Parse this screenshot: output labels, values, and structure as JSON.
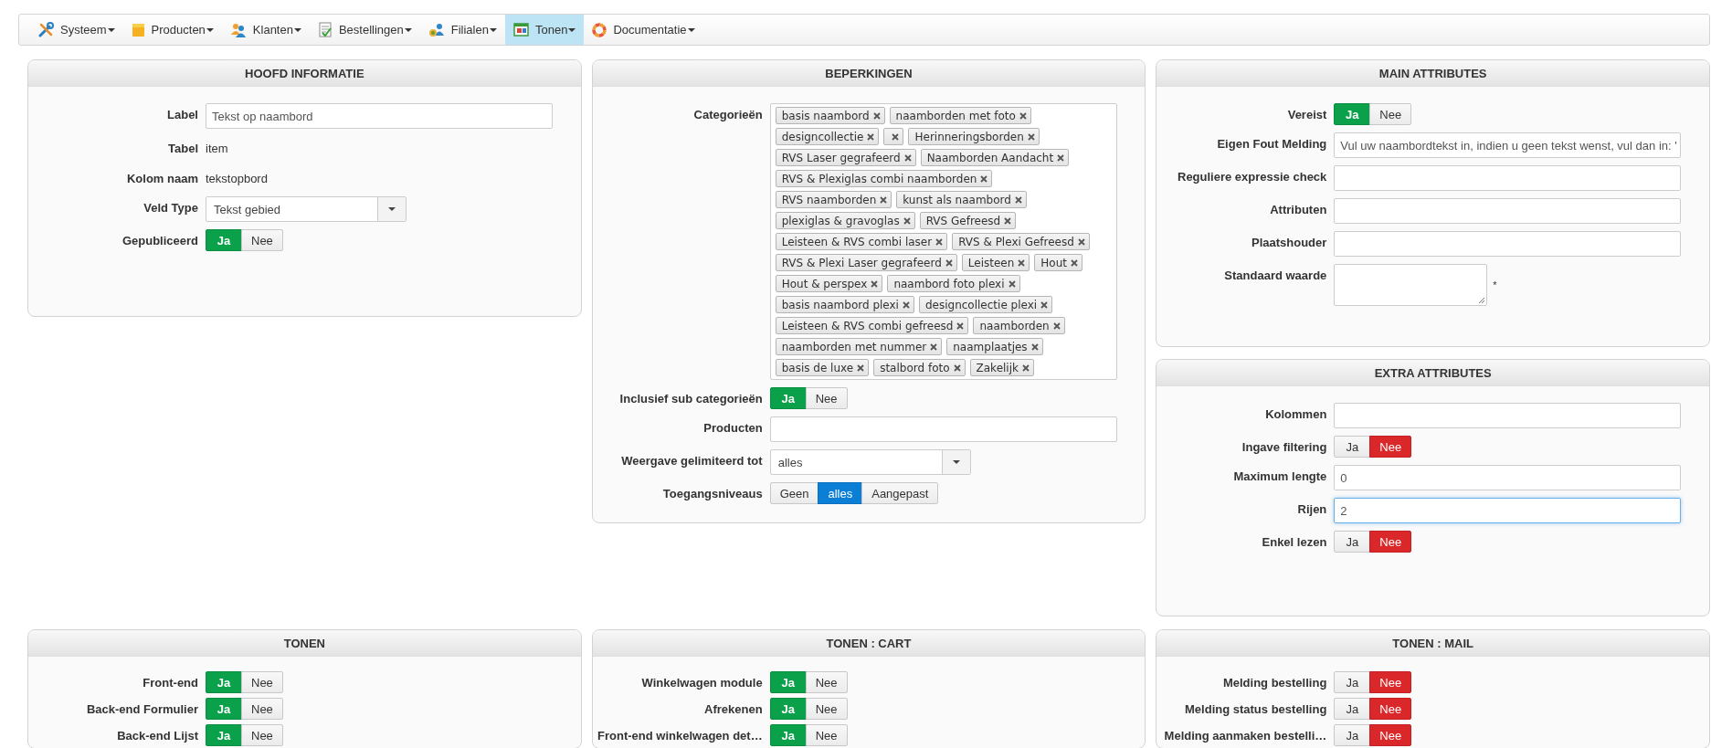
{
  "nav": {
    "items": [
      {
        "label": "Systeem",
        "selected": false
      },
      {
        "label": "Producten",
        "selected": false
      },
      {
        "label": "Klanten",
        "selected": false
      },
      {
        "label": "Bestellingen",
        "selected": false
      },
      {
        "label": "Filialen",
        "selected": false
      },
      {
        "label": "Tonen",
        "selected": true
      },
      {
        "label": "Documentatie",
        "selected": false
      }
    ]
  },
  "top_row": {
    "columns": [
      [
        {
          "title": "HOOFD INFORMATIE",
          "rows": [
            {
              "kind": "input",
              "label": "Label",
              "value": "Tekst op naambord",
              "focused": false
            },
            {
              "kind": "text",
              "label": "Tabel",
              "value": "item"
            },
            {
              "kind": "text",
              "label": "Kolom naam",
              "value": "tekstopbord"
            },
            {
              "kind": "select",
              "label": "Veld Type",
              "value": "Tekst gebied"
            },
            {
              "kind": "toggle",
              "label": "Gepubliceerd",
              "options": [
                {
                  "label": "Ja",
                  "selected": true
                },
                {
                  "label": "Nee",
                  "selected": false
                }
              ]
            }
          ]
        }
      ],
      [
        {
          "title": "BEPERKINGEN",
          "rows": [
            {
              "kind": "tags",
              "label": "Categorieën",
              "tags": [
                {
                  "label": "basis naambord"
                },
                {
                  "label": "naamborden met foto"
                },
                {
                  "label": "designcollectie"
                },
                {
                  "kind": "blank"
                },
                {
                  "label": "Herinneringsborden"
                },
                {
                  "label": "RVS Laser gegrafeerd"
                },
                {
                  "label": "Naamborden Aandacht"
                },
                {
                  "label": "RVS & Plexiglas combi naamborden"
                },
                {
                  "label": "RVS naamborden"
                },
                {
                  "label": "kunst als naambord"
                },
                {
                  "label": "plexiglas & gravoglas"
                },
                {
                  "label": "RVS Gefreesd"
                },
                {
                  "label": "Leisteen & RVS combi laser"
                },
                {
                  "label": "RVS & Plexi Gefreesd"
                },
                {
                  "label": "RVS & Plexi Laser gegrafeerd"
                },
                {
                  "label": "Leisteen"
                },
                {
                  "label": "Hout"
                },
                {
                  "label": "Hout & perspex"
                },
                {
                  "label": "naambord foto plexi"
                },
                {
                  "label": "basis naambord plexi"
                },
                {
                  "label": "designcollectie plexi"
                },
                {
                  "label": "Leisteen & RVS combi gefreesd"
                },
                {
                  "label": "naamborden"
                },
                {
                  "label": "naamborden met nummer"
                },
                {
                  "label": "naamplaatjes"
                },
                {
                  "label": "basis de luxe"
                },
                {
                  "label": "stalbord foto"
                },
                {
                  "label": "Zakelijk"
                }
              ]
            },
            {
              "kind": "toggle",
              "label": "Inclusief sub categorieën",
              "options": [
                {
                  "label": "Ja",
                  "selected": true
                },
                {
                  "label": "Nee",
                  "selected": false
                }
              ]
            },
            {
              "kind": "input",
              "label": "Producten",
              "focused": false
            },
            {
              "kind": "select",
              "label": "Weergave gelimiteerd tot",
              "value": "alles"
            },
            {
              "kind": "segmented",
              "label": "Toegangsniveaus",
              "options": [
                {
                  "label": "Geen",
                  "selected": false
                },
                {
                  "label": "alles",
                  "selected": true
                },
                {
                  "label": "Aangepast",
                  "selected": false
                }
              ]
            }
          ]
        }
      ],
      [
        {
          "title": "MAIN ATTRIBUTES",
          "rows": [
            {
              "kind": "toggle",
              "label": "Vereist",
              "options": [
                {
                  "label": "Ja",
                  "selected": true
                },
                {
                  "label": "Nee",
                  "selected": false
                }
              ]
            },
            {
              "kind": "input",
              "label": "Eigen Fout Melding",
              "value": "Vul uw naambordtekst in, indien u geen tekst wenst, vul dan in: '",
              "focused": false
            },
            {
              "kind": "input",
              "label": "Reguliere expressie check",
              "focused": false
            },
            {
              "kind": "input",
              "label": "Attributen",
              "focused": false
            },
            {
              "kind": "input",
              "label": "Plaatshouder",
              "focused": false
            },
            {
              "kind": "textarea",
              "label": "Standaard waarde",
              "note": "*"
            }
          ]
        },
        {
          "title": "EXTRA ATTRIBUTES",
          "rows": [
            {
              "kind": "input",
              "label": "Kolommen",
              "focused": false
            },
            {
              "kind": "toggle",
              "label": "Ingave filtering",
              "options": [
                {
                  "label": "Ja",
                  "selected": false
                },
                {
                  "label": "Nee",
                  "selected": true
                }
              ]
            },
            {
              "kind": "input",
              "label": "Maximum lengte",
              "value": "0",
              "focused": false
            },
            {
              "kind": "input",
              "label": "Rijen",
              "value": "2",
              "focused": true
            },
            {
              "kind": "toggle",
              "label": "Enkel lezen",
              "options": [
                {
                  "label": "Ja",
                  "selected": false
                },
                {
                  "label": "Nee",
                  "selected": true
                }
              ]
            }
          ]
        }
      ]
    ]
  },
  "bottom_row": {
    "panels": [
      {
        "title": "TONEN",
        "rows": [
          {
            "kind": "toggle",
            "label": "Front-end",
            "options": [
              {
                "label": "Ja",
                "selected": true
              },
              {
                "label": "Nee",
                "selected": false
              }
            ]
          },
          {
            "kind": "toggle",
            "label": "Back-end Formulier",
            "options": [
              {
                "label": "Ja",
                "selected": true
              },
              {
                "label": "Nee",
                "selected": false
              }
            ]
          },
          {
            "kind": "toggle",
            "label": "Back-end Lijst",
            "options": [
              {
                "label": "Ja",
                "selected": true
              },
              {
                "label": "Nee",
                "selected": false
              }
            ]
          }
        ]
      },
      {
        "title": "TONEN : CART",
        "rows": [
          {
            "kind": "toggle",
            "label": "Winkelwagen module",
            "options": [
              {
                "label": "Ja",
                "selected": true
              },
              {
                "label": "Nee",
                "selected": false
              }
            ]
          },
          {
            "kind": "toggle",
            "label": "Afrekenen",
            "options": [
              {
                "label": "Ja",
                "selected": true
              },
              {
                "label": "Nee",
                "selected": false
              }
            ]
          },
          {
            "kind": "toggle",
            "label": "Front-end winkelwagen det…",
            "options": [
              {
                "label": "Ja",
                "selected": true
              },
              {
                "label": "Nee",
                "selected": false
              }
            ]
          }
        ]
      },
      {
        "title": "TONEN : MAIL",
        "rows": [
          {
            "kind": "toggle",
            "label": "Melding bestelling",
            "options": [
              {
                "label": "Ja",
                "selected": false
              },
              {
                "label": "Nee",
                "selected": true
              }
            ]
          },
          {
            "kind": "toggle",
            "label": "Melding status bestelling",
            "options": [
              {
                "label": "Ja",
                "selected": false
              },
              {
                "label": "Nee",
                "selected": true
              }
            ]
          },
          {
            "kind": "toggle",
            "label": "Melding aanmaken bestelli…",
            "options": [
              {
                "label": "Ja",
                "selected": false
              },
              {
                "label": "Nee",
                "selected": true
              }
            ]
          }
        ]
      }
    ]
  }
}
